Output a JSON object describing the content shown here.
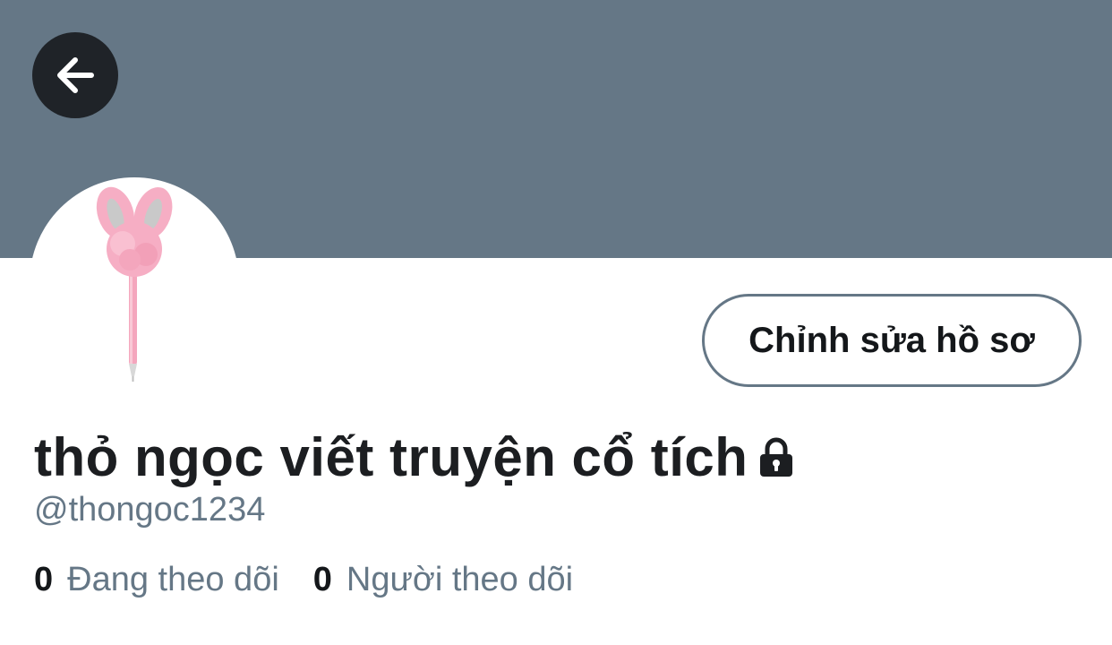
{
  "header": {
    "back_icon": "arrow-left-icon",
    "banner_color": "#657786"
  },
  "profile": {
    "avatar": "pink-bunny-pen",
    "edit_button_label": "Chỉnh sửa hồ sơ",
    "display_name": "thỏ ngọc viết truyện cổ tích",
    "protected_icon": "lock-icon",
    "handle": "@thongoc1234",
    "following": {
      "count": "0",
      "label": "Đang theo dõi"
    },
    "followers": {
      "count": "0",
      "label": "Người theo dõi"
    }
  },
  "colors": {
    "text_primary": "#14171a",
    "text_secondary": "#657786",
    "back_button_bg": "#1f2328"
  }
}
